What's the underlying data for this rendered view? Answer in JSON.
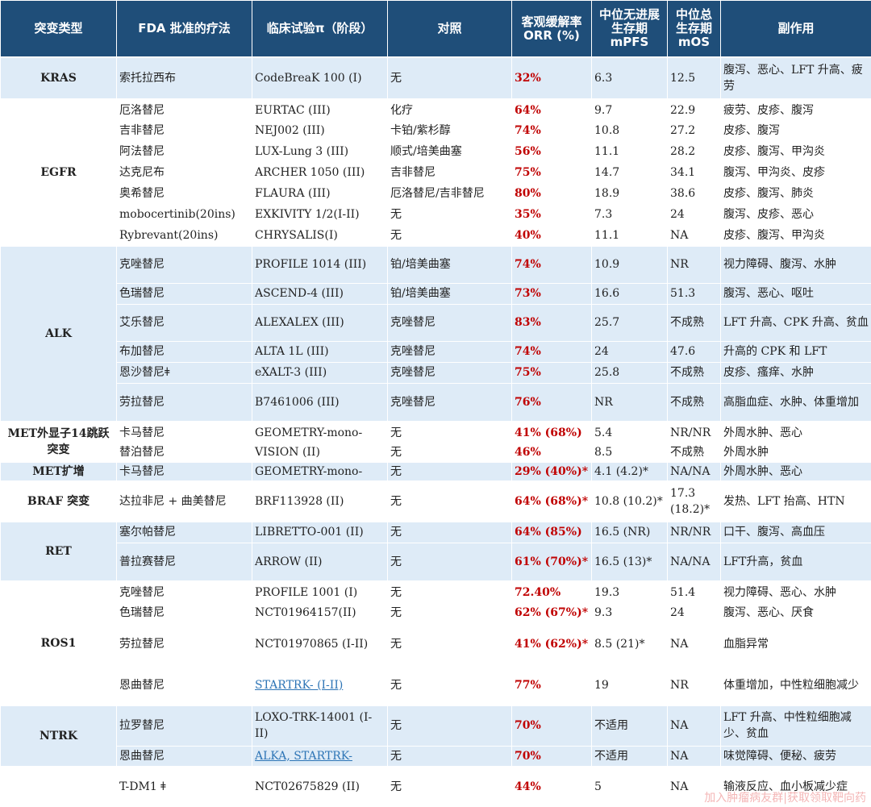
{
  "headers": [
    "突变类型",
    "FDA 批准的疗法",
    "临床试验π（阶段）",
    "对照",
    "客观缓解率\nORR (%)",
    "中位无进展\n生存期\nmPFS",
    "中位总\n生存期\nmOS",
    "副作用"
  ],
  "groups": {
    "kras": {
      "type": "KRAS",
      "rows": [
        {
          "drug": "索托拉西布",
          "trial": "CodeBreaK 100  (I)",
          "control": "无",
          "orr": "32%",
          "mpfs": "6.3",
          "mos": "12.5",
          "ae": "腹泻、恶心、LFT 升高、疲劳"
        }
      ]
    },
    "egfr": {
      "type": "EGFR",
      "rows": [
        {
          "drug": "厄洛替尼",
          "trial": "EURTAC  (III)",
          "control": "化疗",
          "orr": "64%",
          "mpfs": "9.7",
          "mos": "22.9",
          "ae": "疲劳、皮疹、腹泻"
        },
        {
          "drug": "吉非替尼",
          "trial": "NEJ002  (III)",
          "control": "卡铂/紫杉醇",
          "orr": "74%",
          "mpfs": "10.8",
          "mos": "27.2",
          "ae": "皮疹、腹泻"
        },
        {
          "drug": "阿法替尼",
          "trial": "LUX-Lung 3  (III)",
          "control": "顺式/培美曲塞",
          "orr": "56%",
          "mpfs": "11.1",
          "mos": "28.2",
          "ae": "皮疹、腹泻、甲沟炎"
        },
        {
          "drug": "达克尼布",
          "trial": "ARCHER 1050  (III)",
          "control": "吉非替尼",
          "orr": "75%",
          "mpfs": "14.7",
          "mos": "34.1",
          "ae": "腹泻、甲沟炎、皮疹"
        },
        {
          "drug": "奥希替尼",
          "trial": "FLAURA  (III)",
          "control": "厄洛替尼/吉非替尼",
          "orr": "80%",
          "mpfs": "18.9",
          "mos": "38.6",
          "ae": "皮疹、腹泻、肺炎"
        },
        {
          "drug": "mobocertinib(20ins)",
          "trial": "EXKIVITY 1/2(I-II)",
          "control": "无",
          "orr": "35%",
          "mpfs": "7.3",
          "mos": "24",
          "ae": "腹泻、皮疹、恶心"
        },
        {
          "drug": "Rybrevant(20ins)",
          "trial": "CHRYSALIS(I)",
          "control": "无",
          "orr": "40%",
          "mpfs": "11.1",
          "mos": "NA",
          "ae": "皮疹、腹泻、甲沟炎"
        }
      ]
    },
    "alk": {
      "type": "ALK",
      "rows": [
        {
          "drug": "克唑替尼",
          "trial": "PROFILE 1014  (III)",
          "control": "铂/培美曲塞",
          "orr": "74%",
          "mpfs": "10.9",
          "mos": "NR",
          "ae": "视力障碍、腹泻、水肿"
        },
        {
          "drug": "色瑞替尼",
          "trial": "ASCEND-4  (III)",
          "control": "铂/培美曲塞",
          "orr": "73%",
          "mpfs": "16.6",
          "mos": "51.3",
          "ae": "腹泻、恶心、呕吐"
        },
        {
          "drug": "艾乐替尼",
          "trial": "ALEXALEX  (III)",
          "control": "克唑替尼",
          "orr": "83%",
          "mpfs": "25.7",
          "mos": "不成熟",
          "ae": "LFT 升高、CPK 升高、贫血"
        },
        {
          "drug": "布加替尼",
          "trial": "ALTA 1L  (III)",
          "control": "克唑替尼",
          "orr": "74%",
          "mpfs": "24",
          "mos": "47.6",
          "ae": "升高的 CPK 和 LFT"
        },
        {
          "drug": "恩沙替尼ǂ",
          "trial": "eXALT-3  (III)",
          "control": "克唑替尼",
          "orr": "75%",
          "mpfs": "25.8",
          "mos": "不成熟",
          "ae": "皮疹、瘙痒、水肿"
        },
        {
          "drug": "劳拉替尼",
          "trial": "B7461006  (III)",
          "control": "克唑替尼",
          "orr": "76%",
          "mpfs": "NR",
          "mos": "不成熟",
          "ae": "高脂血症、水肿、体重增加"
        }
      ]
    },
    "met14": {
      "type": "MET外显子14跳跃突变",
      "rows": [
        {
          "drug": "卡马替尼",
          "trial": "GEOMETRY-mono-",
          "control": "无",
          "orr": "41% (68%)",
          "mpfs": "5.4",
          "mos": "NR/NR",
          "ae": "外周水肿、恶心"
        },
        {
          "drug": "替泊替尼",
          "trial": "VISION  (II)",
          "control": "无",
          "orr": "46%",
          "mpfs": "8.5",
          "mos": "不成熟",
          "ae": "外周水肿"
        }
      ]
    },
    "metamp": {
      "type": "MET扩增",
      "rows": [
        {
          "drug": "卡马替尼",
          "trial": "GEOMETRY-mono-",
          "control": "无",
          "orr": "29% (40%)*",
          "mpfs": "4.1 (4.2)*",
          "mos": "NA/NA",
          "ae": "外周水肿、恶心"
        }
      ]
    },
    "braf": {
      "type": "BRAF 突变",
      "rows": [
        {
          "drug": "达拉非尼 + 曲美替尼",
          "trial": "BRF113928  (II)",
          "control": "无",
          "orr": "64% (68%)*",
          "mpfs": "10.8 (10.2)*",
          "mos": "17.3 (18.2)*",
          "ae": "发热、LFT 抬高、HTN"
        }
      ]
    },
    "ret": {
      "type": "RET",
      "rows": [
        {
          "drug": "塞尔帕替尼",
          "trial": "LIBRETTO-001  (II)",
          "control": "无",
          "orr": "64% (85%)",
          "mpfs": "16.5 (NR)",
          "mos": "NR/NR",
          "ae": "口干、腹泻、高血压"
        },
        {
          "drug": "普拉赛替尼",
          "trial": "ARROW  (II)",
          "control": "无",
          "orr": "61% (70%)*",
          "mpfs": "16.5 (13)*",
          "mos": "NA/NA",
          "ae": "LFT升高，贫血"
        }
      ]
    },
    "ros1": {
      "type": "ROS1",
      "rows": [
        {
          "drug": "克唑替尼",
          "trial": "PROFILE 1001  (I)",
          "control": "无",
          "orr": "72.40%",
          "mpfs": "19.3",
          "mos": "51.4",
          "ae": "视力障碍、恶心、水肿"
        },
        {
          "drug": "色瑞替尼",
          "trial": "NCT01964157(II)",
          "control": "无",
          "orr": "62% (67%)*",
          "mpfs": "9.3",
          "mos": "24",
          "ae": "腹泻、恶心、厌食"
        },
        {
          "drug": "劳拉替尼",
          "trial": "NCT01970865  (I-II)",
          "control": "无",
          "orr": "41% (62%)*",
          "mpfs": "8.5 (21)*",
          "mos": "NA",
          "ae": "血脂异常"
        },
        {
          "drug": "恩曲替尼",
          "trial": "STARTRK- (I-II)",
          "control": "无",
          "orr": "77%",
          "mpfs": "19",
          "mos": "NR",
          "ae": "体重增加，中性粒细胞减少"
        }
      ]
    },
    "ntrk": {
      "type": "NTRK",
      "rows": [
        {
          "drug": "拉罗替尼",
          "trial": "LOXO-TRK-14001  (I-II)",
          "control": "无",
          "orr": "70%",
          "mpfs": "不适用",
          "mos": "NA",
          "ae": "LFT 升高、中性粒细胞减少、贫血"
        },
        {
          "drug": "恩曲替尼",
          "trial": "ALKA,  STARTRK-",
          "control": "无",
          "orr": "70%",
          "mpfs": "不适用",
          "mos": "NA",
          "ae": "味觉障碍、便秘、疲劳"
        }
      ]
    },
    "last": {
      "rows": [
        {
          "drug": "T-DM1  ǂ",
          "trial": "NCT02675829  (II)",
          "control": "无",
          "orr": "44%",
          "mpfs": "5",
          "mos": "NA",
          "ae": "输液反应、血小板减少症"
        }
      ]
    }
  },
  "watermark": "加入肿瘤病友群|获取领取靶向药"
}
